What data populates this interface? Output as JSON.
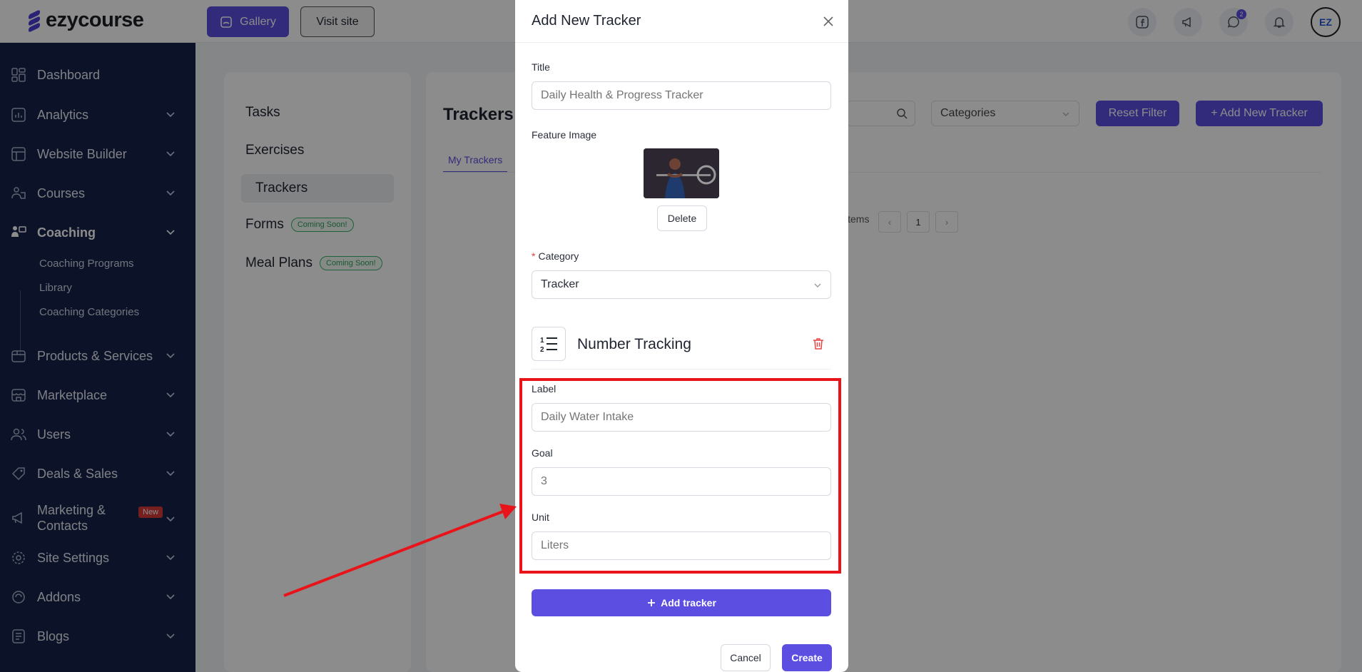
{
  "header": {
    "logo_text": "ezycourse",
    "gallery_label": "Gallery",
    "visit_site_label": "Visit site",
    "chat_badge_count": "2",
    "avatar_initials": "EZ"
  },
  "sidebar": {
    "items": [
      {
        "label": "Dashboard",
        "icon": "dashboard-icon"
      },
      {
        "label": "Analytics",
        "icon": "analytics-icon"
      },
      {
        "label": "Website Builder",
        "icon": "website-builder-icon"
      },
      {
        "label": "Courses",
        "icon": "courses-icon"
      },
      {
        "label": "Coaching",
        "icon": "coaching-icon"
      },
      {
        "label": "Products & Services",
        "icon": "products-icon"
      },
      {
        "label": "Marketplace",
        "icon": "marketplace-icon"
      },
      {
        "label": "Users",
        "icon": "users-icon"
      },
      {
        "label": "Deals & Sales",
        "icon": "deals-icon"
      },
      {
        "label": "Marketing & Contacts",
        "icon": "marketing-icon"
      },
      {
        "label": "Site Settings",
        "icon": "settings-icon"
      },
      {
        "label": "Addons",
        "icon": "addons-icon"
      },
      {
        "label": "Blogs",
        "icon": "blogs-icon"
      }
    ],
    "marketing_line1": "Marketing &",
    "marketing_line2": "Contacts",
    "new_badge": "New",
    "coaching_subitems": [
      "Coaching Programs",
      "Library",
      "Coaching Categories"
    ]
  },
  "coaching_menu": {
    "items": [
      "Tasks",
      "Exercises",
      "Trackers",
      "Forms",
      "Meal Plans"
    ],
    "coming_soon": "Coming Soon!"
  },
  "trackers_page": {
    "title": "Trackers",
    "tab_my_trackers": "My Trackers",
    "categories_placeholder": "Categories",
    "reset_filter": "Reset Filter",
    "add_new_tracker": "+ Add New Tracker",
    "items_text": "items",
    "page_number": "1"
  },
  "modal": {
    "title": "Add New Tracker",
    "title_label": "Title",
    "title_placeholder": "Daily Health & Progress Tracker",
    "feature_image_label": "Feature Image",
    "delete_label": "Delete",
    "category_label": "Category",
    "category_value": "Tracker",
    "tracker_type": "Number Tracking",
    "label_label": "Label",
    "label_placeholder": "Daily Water Intake",
    "goal_label": "Goal",
    "goal_value": "3",
    "unit_label": "Unit",
    "unit_placeholder": "Liters",
    "add_tracker_label": "Add tracker",
    "cancel_label": "Cancel",
    "create_label": "Create"
  },
  "colors": {
    "accent": "#5b4ee0",
    "sidebar_bg": "#17244a",
    "highlight": "#e8141a",
    "coming_soon": "#2f9e58"
  }
}
